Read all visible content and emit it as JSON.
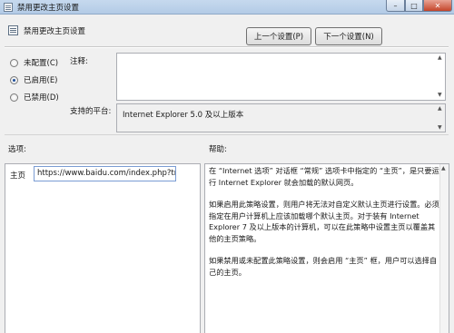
{
  "window": {
    "title": "禁用更改主页设置",
    "close_glyph": "✕",
    "min_glyph": "–",
    "max_glyph": "□"
  },
  "header": {
    "title": "禁用更改主页设置",
    "prev_button": "上一个设置(P)",
    "next_button": "下一个设置(N)"
  },
  "state": {
    "options": [
      {
        "label": "未配置(C)",
        "selected": false
      },
      {
        "label": "已启用(E)",
        "selected": true
      },
      {
        "label": "已禁用(D)",
        "selected": false
      }
    ]
  },
  "comment": {
    "label": "注释:",
    "value": ""
  },
  "platform": {
    "label": "支持的平台:",
    "value": "Internet Explorer 5.0 及以上版本"
  },
  "options_panel": {
    "heading": "选项:",
    "homepage_label": "主页",
    "homepage_value": "https://www.baidu.com/index.php?tn"
  },
  "help_panel": {
    "heading": "帮助:",
    "paragraphs": [
      "在 “Internet 选项” 对话框 “常规” 选项卡中指定的 “主页”，是只要运行 Internet Explorer 就会加载的默认网页。",
      "如果启用此策略设置，则用户将无法对自定义默认主页进行设置。必须指定在用户计算机上应该加载哪个默认主页。对于装有 Internet Explorer 7 及以上版本的计算机，可以在此策略中设置主页以覆盖其他的主页策略。",
      "如果禁用或未配置此策略设置，则会启用 “主页” 框，用户可以选择自己的主页。"
    ]
  },
  "icons": {
    "title_icon": "policy-settings-icon",
    "header_icon": "policy-settings-icon"
  }
}
